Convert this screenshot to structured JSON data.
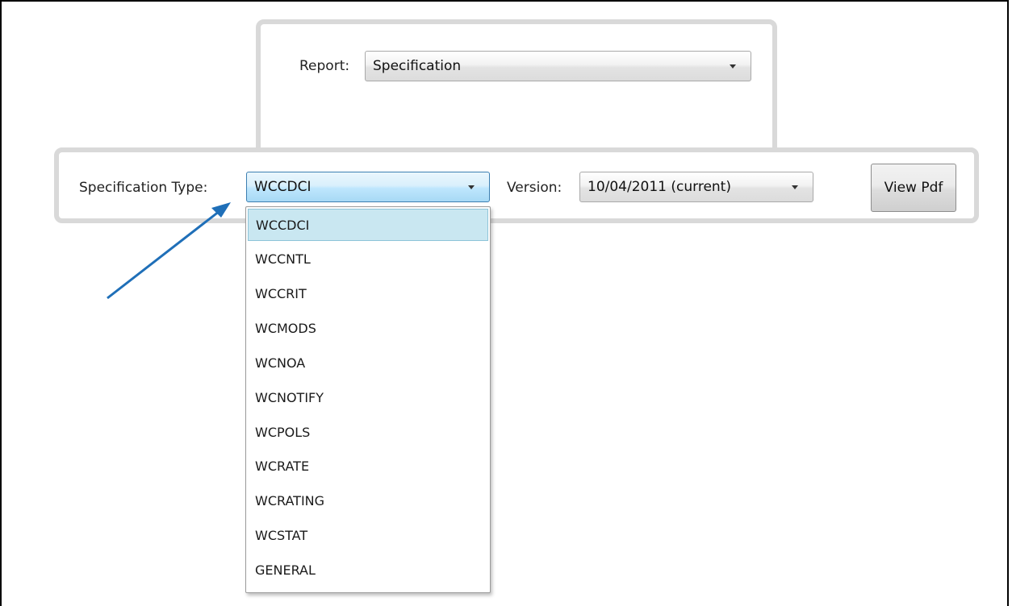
{
  "report": {
    "label": "Report:",
    "value": "Specification"
  },
  "spec": {
    "type_label": "Specification Type:",
    "type_value": "WCCDCI",
    "version_label": "Version:",
    "version_value": "10/04/2011 (current)",
    "view_pdf_label": "View Pdf"
  },
  "dropdown": {
    "items": [
      "WCCDCI",
      "WCCNTL",
      "WCCRIT",
      "WCMODS",
      "WCNOA",
      "WCNOTIFY",
      "WCPOLS",
      "WCRATE",
      "WCRATING",
      "WCSTAT",
      "GENERAL"
    ],
    "selected_index": 0
  },
  "colors": {
    "annotation_arrow": "#1f6fb8",
    "selected_item_bg": "#c9e7f1",
    "panel_border": "#d9d9d9"
  }
}
